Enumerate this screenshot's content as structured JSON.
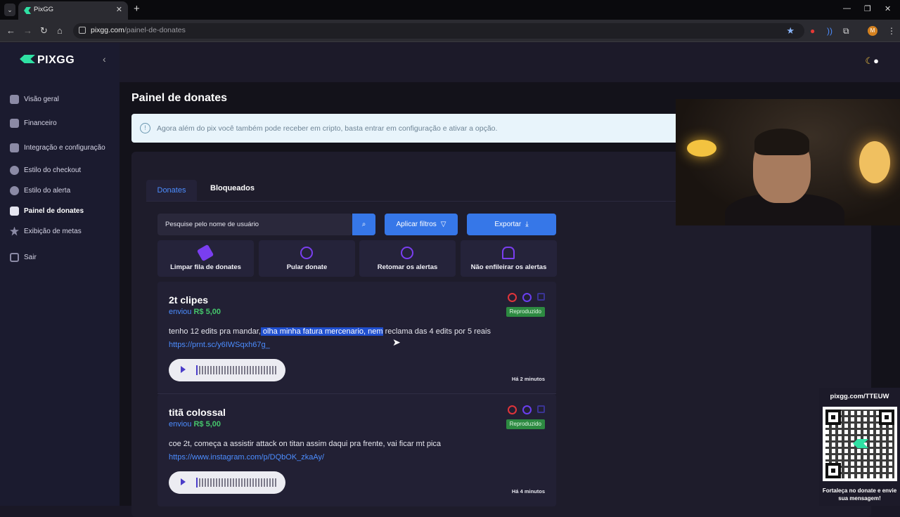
{
  "browser": {
    "tab_title": "PixGG",
    "url_host": "pixgg.com",
    "url_path": "/painel-de-donates",
    "avatar_letter": "M"
  },
  "sidebar": {
    "logo": "PIXGG",
    "items": [
      {
        "label": "Visão geral",
        "icon": "home-icon"
      },
      {
        "label": "Financeiro",
        "icon": "wallet-icon"
      },
      {
        "label": "Integração e configuração",
        "icon": "document-icon"
      },
      {
        "label": "Estilo do checkout",
        "icon": "palette-icon"
      },
      {
        "label": "Estilo do alerta",
        "icon": "palette-icon"
      },
      {
        "label": "Painel de donates",
        "icon": "donate-icon",
        "active": true
      },
      {
        "label": "Exibição de metas",
        "icon": "star-icon"
      },
      {
        "label": "Sair",
        "icon": "logout-icon"
      }
    ]
  },
  "main": {
    "title": "Painel de donates",
    "info": "Agora além do pix você também pode receber em cripto, basta entrar em configuração e ativar a opção.",
    "tabs": [
      "Donates",
      "Bloqueados"
    ],
    "search_placeholder": "Pesquise pelo nome de usuário",
    "filter_button": "Aplicar filtros",
    "export_button": "Exportar",
    "actions": [
      {
        "label": "Limpar fila de donates",
        "icon": "eraser-icon"
      },
      {
        "label": "Pular donate",
        "icon": "skip-icon"
      },
      {
        "label": "Retomar os alertas",
        "icon": "play-icon"
      },
      {
        "label": "Não enfileirar os alertas",
        "icon": "bell-off-icon"
      }
    ],
    "donates": [
      {
        "name": "2t clipes",
        "sent": "enviou",
        "value": "R$ 5,00",
        "msg_before": "tenho 12 edits pra mandar,",
        "msg_highlight": " olha minha fatura mercenario, nem",
        "msg_after": " reclama das 4 edits por 5 reais",
        "link": "https://prnt.sc/y6IWSqxh67g_",
        "status": "Reproduzido",
        "time": "Há 2 minutos"
      },
      {
        "name": "titã colossal",
        "sent": "enviou",
        "value": "R$ 5,00",
        "msg_before": "coe 2t, começa a assistir attack on titan assim daqui pra frente, vai ficar mt pica",
        "msg_highlight": "",
        "msg_after": "",
        "link": "https://www.instagram.com/p/DQbOK_zkaAy/",
        "status": "Reproduzido",
        "time": "Há 4 minutos"
      }
    ]
  },
  "overlay": {
    "qr_url": "pixgg.com/TTEUW",
    "qr_caption": "Fortaleça no donate e envie sua mensagem!"
  }
}
